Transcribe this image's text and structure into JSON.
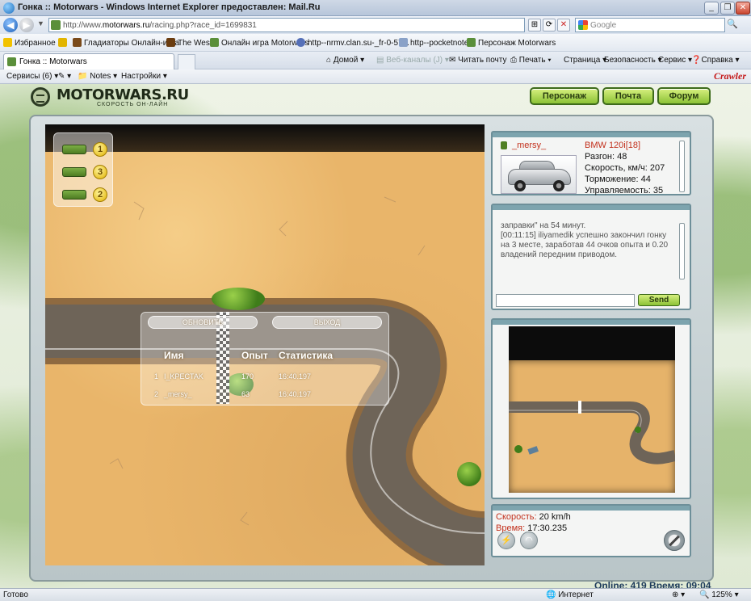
{
  "window": {
    "title": "Гонка :: Motorwars - Windows Internet Explorer предоставлен: Mail.Ru"
  },
  "navigation": {
    "url_prefix": "http://www.",
    "url_domain": "motorwars.ru",
    "url_path": "/racing.php?race_id=1699831",
    "search_placeholder": "Google"
  },
  "favorites": {
    "label": "Избранное",
    "links": [
      "Гладиаторы Онлайн-игра",
      "The West",
      "Онлайн игра Motorwars",
      "http--nrmv.clan.su-_fr-0-57...",
      "http--pocketnotes",
      "Персонаж  Motorwars"
    ]
  },
  "tabs": {
    "active": "Гонка :: Motorwars"
  },
  "commands": {
    "home": "Домой",
    "feeds": "Веб-каналы (J)",
    "read_mail": "Читать почту",
    "print": "Печать",
    "page": "Страница",
    "safety": "Безопасность",
    "tools": "Сервис",
    "help": "Справка"
  },
  "toolbar3": {
    "services": "Сервисы (6)",
    "notes": "Notes",
    "settings": "Настройки",
    "brand": "Crawler"
  },
  "site": {
    "logo": "MOTORWARS.RU",
    "tagline": "СКОРОСТЬ ОН-ЛАЙН",
    "nav": [
      "Персонаж",
      "Почта",
      "Форум"
    ]
  },
  "race": {
    "positions": [
      "1",
      "3",
      "2"
    ],
    "buttons": {
      "refresh": "ОБНОВИТЬ",
      "exit": "ВЫХОД"
    },
    "columns": [
      "Имя",
      "Опыт",
      "Статистика"
    ],
    "rows": [
      {
        "place": "1",
        "name": "I_KPECTAK",
        "exp": "170",
        "time": "16:40.197"
      },
      {
        "place": "2",
        "name": "_mersy_",
        "exp": "63",
        "time": "16:40.197"
      }
    ]
  },
  "player": {
    "name": "_mersy_",
    "car": "BMW 120i[18]",
    "stats": [
      "Разгон: 48",
      "Скорость, км/ч: 207",
      "Торможение: 44",
      "Управляемость: 35"
    ]
  },
  "chat": {
    "log": "заправки\" на 54 минут.\n[00:11:15] iliyamedik успешно закончил гонку на 3 месте, заработав 44 очков опыта и 0.20 владений передним приводом.",
    "send_label": "Send"
  },
  "telemetry": {
    "speed_label": "Скорость:",
    "speed_value": "20 km/h",
    "time_label": "Время:",
    "time_value": "17:30.235"
  },
  "footer": {
    "online": "Online: 419   Время: 09:04"
  },
  "status": {
    "text": "Готово",
    "zone": "Интернет",
    "zoom": "125%"
  }
}
